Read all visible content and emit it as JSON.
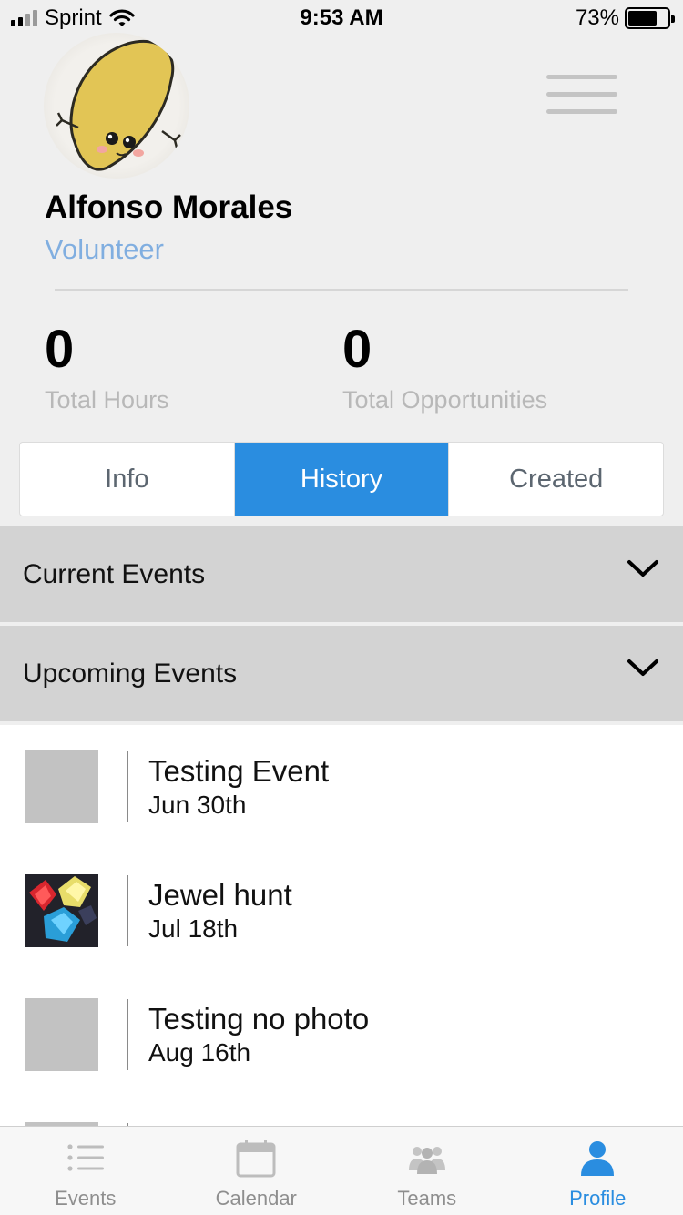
{
  "status_bar": {
    "carrier": "Sprint",
    "time": "9:53 AM",
    "battery_percent": "73%",
    "battery_level": 0.73
  },
  "profile": {
    "name": "Alfonso Morales",
    "role": "Volunteer"
  },
  "stats": [
    {
      "value": "0",
      "label": "Total Hours"
    },
    {
      "value": "0",
      "label": "Total Opportunities"
    }
  ],
  "tabs": [
    {
      "label": "Info",
      "active": false
    },
    {
      "label": "History",
      "active": true
    },
    {
      "label": "Created",
      "active": false
    }
  ],
  "sections": [
    {
      "title": "Current Events",
      "icon": "chevron-down-icon"
    },
    {
      "title": "Upcoming Events",
      "icon": "chevron-down-icon"
    }
  ],
  "events": [
    {
      "title": "Testing Event",
      "date": "Jun 30th",
      "has_photo": false
    },
    {
      "title": "Jewel hunt",
      "date": "Jul 18th",
      "has_photo": true
    },
    {
      "title": "Testing no photo",
      "date": "Aug 16th",
      "has_photo": false
    }
  ],
  "tabbar": [
    {
      "label": "Events",
      "icon": "list-icon",
      "active": false
    },
    {
      "label": "Calendar",
      "icon": "calendar-icon",
      "active": false
    },
    {
      "label": "Teams",
      "icon": "teams-icon",
      "active": false
    },
    {
      "label": "Profile",
      "icon": "person-icon",
      "active": true
    }
  ],
  "colors": {
    "accent": "#2a8de0",
    "role_text": "#80aee0",
    "section_bg": "#d3d3d3",
    "page_bg": "#efefef"
  }
}
